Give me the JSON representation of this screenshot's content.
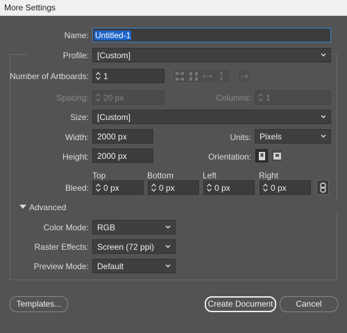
{
  "window": {
    "title": "More Settings"
  },
  "form": {
    "name": {
      "label": "Name:",
      "value": "Untitled-1"
    },
    "profile": {
      "label": "Profile:",
      "value": "[Custom]"
    },
    "artboards": {
      "label": "Number of Artboards:",
      "value": "1"
    },
    "spacing": {
      "label": "Spacing:",
      "value": "20 px"
    },
    "columns": {
      "label": "Columns:",
      "value": "1"
    },
    "size": {
      "label": "Size:",
      "value": "[Custom]"
    },
    "width": {
      "label": "Width:",
      "value": "2000 px"
    },
    "units": {
      "label": "Units:",
      "value": "Pixels"
    },
    "height": {
      "label": "Height:",
      "value": "2000 px"
    },
    "orientation": {
      "label": "Orientation:"
    },
    "bleed": {
      "label": "Bleed:",
      "top": {
        "label": "Top",
        "value": "0 px"
      },
      "bottom": {
        "label": "Bottom",
        "value": "0 px"
      },
      "left": {
        "label": "Left",
        "value": "0 px"
      },
      "right": {
        "label": "Right",
        "value": "0 px"
      }
    },
    "advanced": {
      "label": "Advanced",
      "color_mode": {
        "label": "Color Mode:",
        "value": "RGB"
      },
      "raster_effects": {
        "label": "Raster Effects:",
        "value": "Screen (72 ppi)"
      },
      "preview_mode": {
        "label": "Preview Mode:",
        "value": "Default"
      }
    }
  },
  "footer": {
    "templates_label": "Templates...",
    "create_label": "Create Document",
    "cancel_label": "Cancel"
  },
  "icons": {
    "arrange_grid_row": "grid-by-row-icon",
    "arrange_grid_col": "grid-by-column-icon",
    "arrange_row": "arrange-by-row-icon",
    "arrange_col": "arrange-by-column-icon",
    "layout_direction": "right-to-left-icon",
    "portrait": "portrait-icon",
    "landscape": "landscape-icon",
    "link": "link-bleed-icon"
  }
}
